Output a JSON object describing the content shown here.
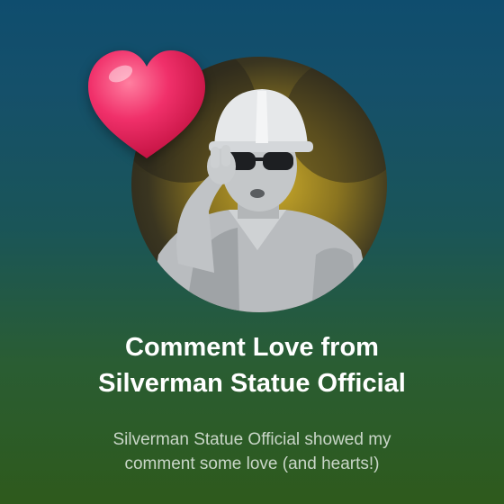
{
  "notification": {
    "title_line1": "Comment Love from",
    "title_line2": "Silverman Statue Official",
    "body_line1": "Silverman Statue Official showed my",
    "body_line2": "comment some love (and hearts!)"
  },
  "avatar": {
    "icon": "profile-photo"
  },
  "badge": {
    "icon": "heart-icon",
    "color": "#e8245a"
  },
  "colors": {
    "background_top": "#0f4d6e",
    "background_bottom": "#2e5a1c",
    "title": "#ffffff",
    "body": "#c9d6c8"
  }
}
